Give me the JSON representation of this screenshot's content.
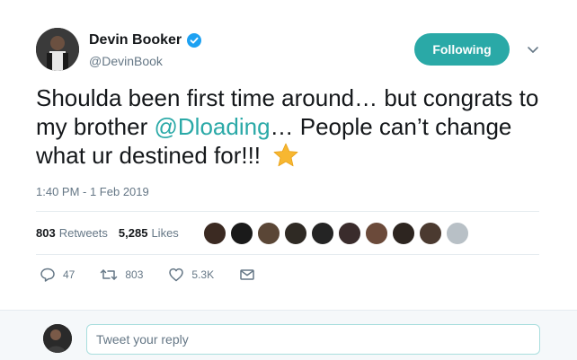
{
  "author": {
    "name": "Devin Booker",
    "handle": "@DevinBook",
    "verified": true
  },
  "follow_button": {
    "label": "Following",
    "color": "#2aa9a7"
  },
  "tweet": {
    "text_before": "Shoulda been first time around… but congrats to my brother ",
    "mention": "@Dloading",
    "text_after": "… People can’t change what ur destined for!!!",
    "emoji": "star-emoji",
    "timestamp": "1:40 PM - 1 Feb 2019"
  },
  "stats": {
    "retweets_count": "803",
    "retweets_label": "Retweets",
    "likes_count": "5,285",
    "likes_label": "Likes"
  },
  "likers": [
    "#3b2a22",
    "#1a1a1a",
    "#5a4636",
    "#2f2a24",
    "#242424",
    "#3a2c2c",
    "#6b4a3a",
    "#2d2520",
    "#4b3a30",
    "#b8c0c6"
  ],
  "actions": {
    "reply_count": "47",
    "retweet_count": "803",
    "like_count": "5.3K"
  },
  "reply": {
    "placeholder": "Tweet your reply"
  },
  "colors": {
    "accent": "#2aa9a7",
    "text": "#14171a",
    "muted": "#657786"
  }
}
